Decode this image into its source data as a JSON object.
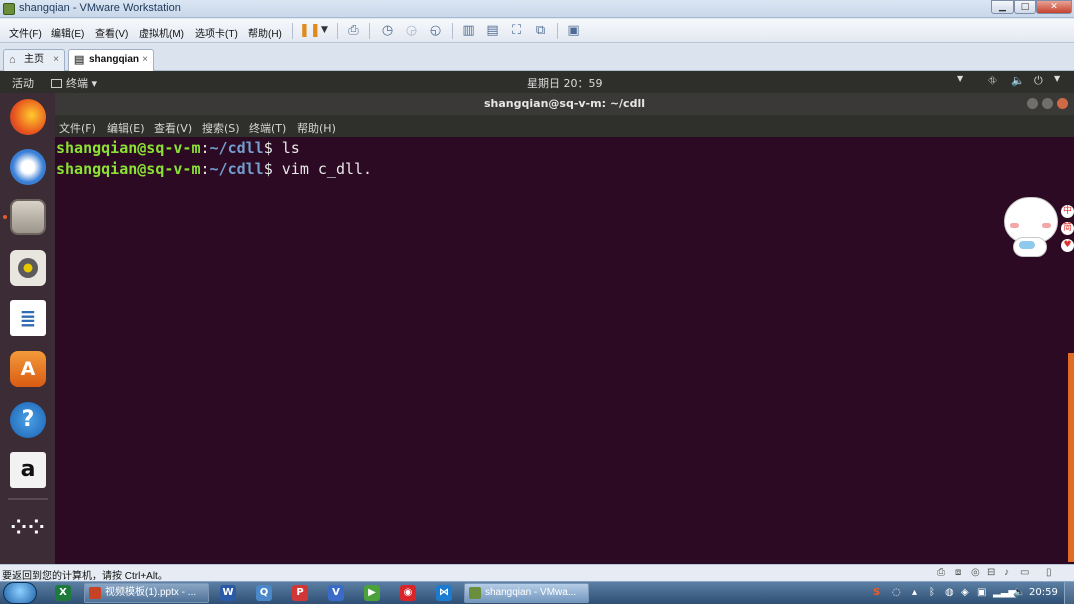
{
  "window": {
    "title": "shangqian - VMware Workstation",
    "min": "▁",
    "max": "□",
    "close": "✕"
  },
  "menu": [
    "文件(F)",
    "编辑(E)",
    "查看(V)",
    "虚拟机(M)",
    "选项卡(T)",
    "帮助(H)"
  ],
  "tabs": [
    {
      "label": "主页",
      "close": "×"
    },
    {
      "label": "shangqian",
      "close": "×"
    }
  ],
  "guest": {
    "activities": "活动",
    "app_menu": "终端 ▾",
    "clock": "星期日 20：59",
    "terminal_title": "shangqian@sq-v-m: ~/cdll",
    "terminal_menu": [
      "文件(F)",
      "编辑(E)",
      "查看(V)",
      "搜索(S)",
      "终端(T)",
      "帮助(H)"
    ],
    "lines": [
      {
        "user": "shangqian@sq-v-m",
        "path": "~/cdll",
        "cmd": "$ ls"
      },
      {
        "user": "shangqian@sq-v-m",
        "path": "~/cdll",
        "cmd": "$ vim c_dll."
      }
    ],
    "dock": [
      "firefox-icon",
      "thunderbird-icon",
      "files-icon",
      "rhythmbox-icon",
      "writer-icon",
      "software-center-icon",
      "help-icon",
      "amazon-icon",
      "show-apps-icon"
    ],
    "sticker_text": [
      "中",
      "简"
    ]
  },
  "status": {
    "message": "要返回到您的计算机，请按 Ctrl+Alt。"
  },
  "taskbar": {
    "ppt": "视频模板(1).pptx - ...",
    "vmware": "shangqian - VMwa...",
    "clock": "20:59",
    "pinned": [
      "X",
      "W",
      "Q",
      "P",
      "V",
      "▶",
      "◉",
      "⋈"
    ]
  },
  "colors": {
    "terminal_bg": "#2c0a23",
    "prompt_user": "#8ae234",
    "prompt_path": "#729fcf",
    "accent": "#e06c26"
  }
}
